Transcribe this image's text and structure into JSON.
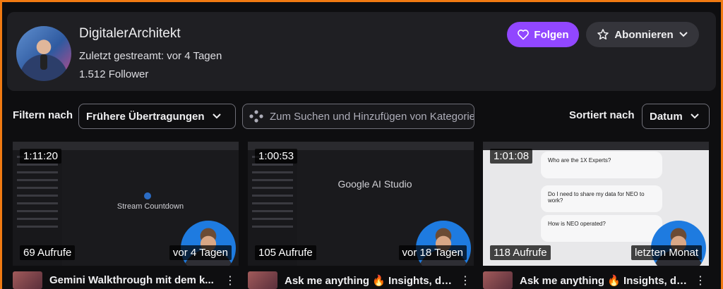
{
  "channel": {
    "name": "DigitalerArchitekt",
    "last_stream": "Zuletzt gestreamt: vor 4 Tagen",
    "followers": "1.512 Follower",
    "follow_label": "Folgen",
    "subscribe_label": "Abonnieren"
  },
  "filters": {
    "filter_label": "Filtern nach",
    "filter_value": "Frühere Übertragungen",
    "search_placeholder": "Zum Suchen und Hinzufügen von Kategorien",
    "sort_label": "Sortiert nach",
    "sort_value": "Datum"
  },
  "videos": [
    {
      "duration": "1:11:20",
      "views": "69 Aufrufe",
      "age": "vor 4 Tagen",
      "title": "Gemini Walkthrough mit dem k...",
      "thumb_text": "Stream Countdown"
    },
    {
      "duration": "1:00:53",
      "views": "105 Aufrufe",
      "age": "vor 18 Tagen",
      "title": "Ask me anything 🔥 Insights, di...",
      "thumb_text": "Google AI Studio"
    },
    {
      "duration": "1:01:08",
      "views": "118 Aufrufe",
      "age": "letzten Monat",
      "title": "Ask me anything 🔥 Insights, di...",
      "thumb_panels": [
        "Who are the 1X Experts?",
        "Do I need to share my data for NEO to work?",
        "How is NEO operated?"
      ]
    }
  ],
  "colors": {
    "accent": "#9147ff",
    "frame": "#f07a12",
    "background": "#0e0e10",
    "card": "#1f1f23"
  }
}
